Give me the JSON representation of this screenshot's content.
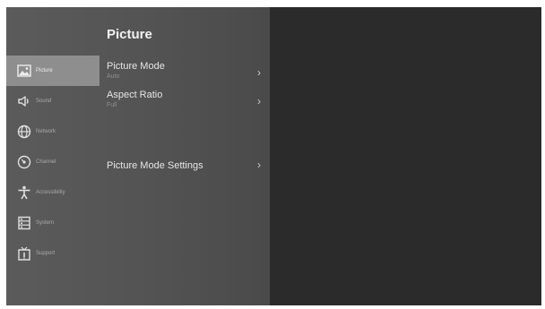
{
  "header": {
    "title": "Picture"
  },
  "sidebar": {
    "items": [
      {
        "label": "Picture",
        "icon": "picture-icon",
        "selected": true
      },
      {
        "label": "Sound",
        "icon": "speaker-icon",
        "selected": false
      },
      {
        "label": "Network",
        "icon": "globe-icon",
        "selected": false
      },
      {
        "label": "Channel",
        "icon": "antenna-icon",
        "selected": false
      },
      {
        "label": "Accessibility",
        "icon": "accessibility-icon",
        "selected": false
      },
      {
        "label": "System",
        "icon": "system-icon",
        "selected": false
      },
      {
        "label": "Support",
        "icon": "support-icon",
        "selected": false
      }
    ]
  },
  "menu": {
    "items": [
      {
        "label": "Picture Mode",
        "value": "Auto"
      },
      {
        "label": "Aspect Ratio",
        "value": "Full"
      },
      {
        "label": "Picture Mode Settings",
        "value": ""
      }
    ]
  },
  "colors": {
    "selected_bg": "#8e8e8e",
    "panel_bg": "#555555",
    "screen_bg": "#2b2b2b"
  }
}
